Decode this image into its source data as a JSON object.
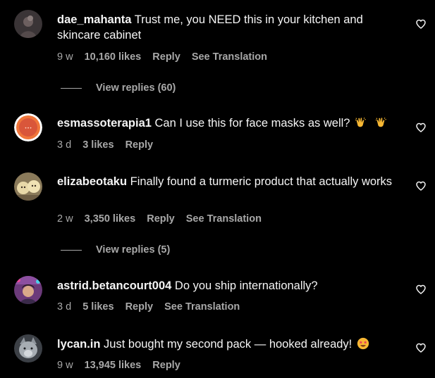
{
  "colors": {
    "background": "#000000",
    "text": "#f5f5f5",
    "secondary": "#a8a8a8"
  },
  "comments": [
    {
      "username": "dae_mahanta",
      "text": "Trust me, you NEED this in your kitchen and skincare cabinet",
      "time": "9 w",
      "likes": "10,160 likes",
      "reply": "Reply",
      "translation": "See Translation",
      "view_replies": "View replies (60)",
      "heart_icon": "heart-outline-icon"
    },
    {
      "username": "esmassoterapia1",
      "text": "Can I use this for face masks as well?",
      "emoji": "clapping-hands-emoji",
      "time": "3 d",
      "likes": "3 likes",
      "reply": "Reply",
      "heart_icon": "heart-outline-icon"
    },
    {
      "username": "elizabeotaku",
      "text": "Finally found a turmeric product that actually works",
      "time": "2 w",
      "likes": "3,350 likes",
      "reply": "Reply",
      "translation": "See Translation",
      "view_replies": "View replies (5)",
      "heart_icon": "heart-outline-icon"
    },
    {
      "username": "astrid.betancourt004",
      "text": "Do you ship internationally?",
      "time": "3 d",
      "likes": "5 likes",
      "reply": "Reply",
      "translation": "See Translation",
      "heart_icon": "heart-outline-icon"
    },
    {
      "username": "lycan.in",
      "text": "Just bought my second pack — hooked already!",
      "emoji": "star-struck-emoji",
      "time": "9 w",
      "likes": "13,945 likes",
      "reply": "Reply",
      "heart_icon": "heart-outline-icon"
    }
  ]
}
